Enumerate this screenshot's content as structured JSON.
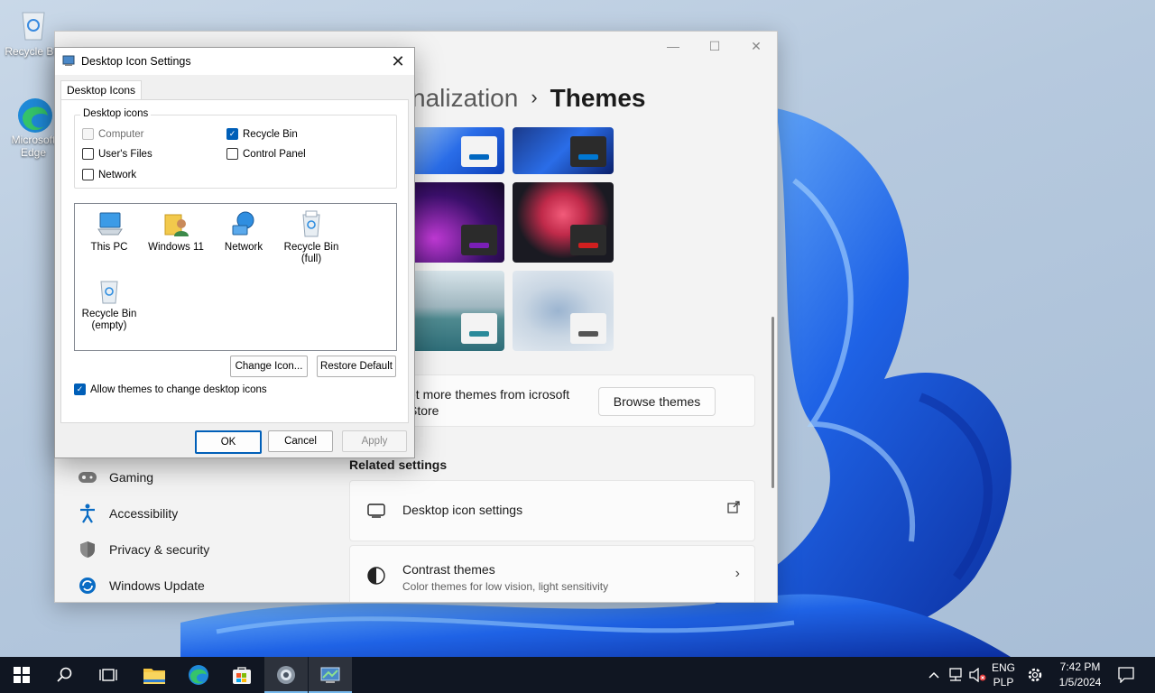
{
  "desktop": {
    "icons": [
      {
        "label": "Recycle Bin",
        "icon": "recycle-bin-icon"
      },
      {
        "label": "Microsoft Edge",
        "icon": "edge-icon"
      }
    ]
  },
  "settings": {
    "breadcrumb_parent": "nalization",
    "breadcrumb_sep": "›",
    "breadcrumb_current": "Themes",
    "window_controls": [
      "—",
      "☐",
      "✕"
    ],
    "get_more_text": "et more themes from icrosoft Store",
    "browse_themes": "Browse themes",
    "related_title": "Related settings",
    "desktop_icon_settings": "Desktop icon settings",
    "contrast_themes": "Contrast themes",
    "contrast_sub": "Color themes for low vision, light sensitivity",
    "nav": [
      {
        "label": "Gaming",
        "icon": "gaming-icon"
      },
      {
        "label": "Accessibility",
        "icon": "accessibility-icon"
      },
      {
        "label": "Privacy & security",
        "icon": "shield-icon"
      },
      {
        "label": "Windows Update",
        "icon": "update-icon"
      }
    ]
  },
  "dialog": {
    "title": "Desktop Icon Settings",
    "tab": "Desktop Icons",
    "group_label": "Desktop icons",
    "checkboxes": {
      "computer": {
        "label": "Computer",
        "checked": false,
        "disabled": true
      },
      "recycle_bin": {
        "label": "Recycle Bin",
        "checked": true
      },
      "users_files": {
        "label": "User's Files",
        "checked": false
      },
      "control_panel": {
        "label": "Control Panel",
        "checked": false
      },
      "network": {
        "label": "Network",
        "checked": false
      }
    },
    "icons": [
      {
        "label": "This PC",
        "icon": "this-pc-icon"
      },
      {
        "label": "Windows 11",
        "icon": "user-folder-icon"
      },
      {
        "label": "Network",
        "icon": "network-icon"
      },
      {
        "label": "Recycle Bin\n(full)",
        "icon": "recycle-bin-full-icon"
      },
      {
        "label": "Recycle Bin\n(empty)",
        "icon": "recycle-bin-empty-icon"
      }
    ],
    "change_icon": "Change Icon...",
    "restore_default": "Restore Default",
    "allow_themes": "Allow themes to change desktop icons",
    "ok": "OK",
    "cancel": "Cancel",
    "apply": "Apply"
  },
  "taskbar": {
    "lang": "ENG",
    "layout": "PLP",
    "time": "7:42 PM",
    "date": "1/5/2024",
    "accent": "#76b9ed"
  }
}
